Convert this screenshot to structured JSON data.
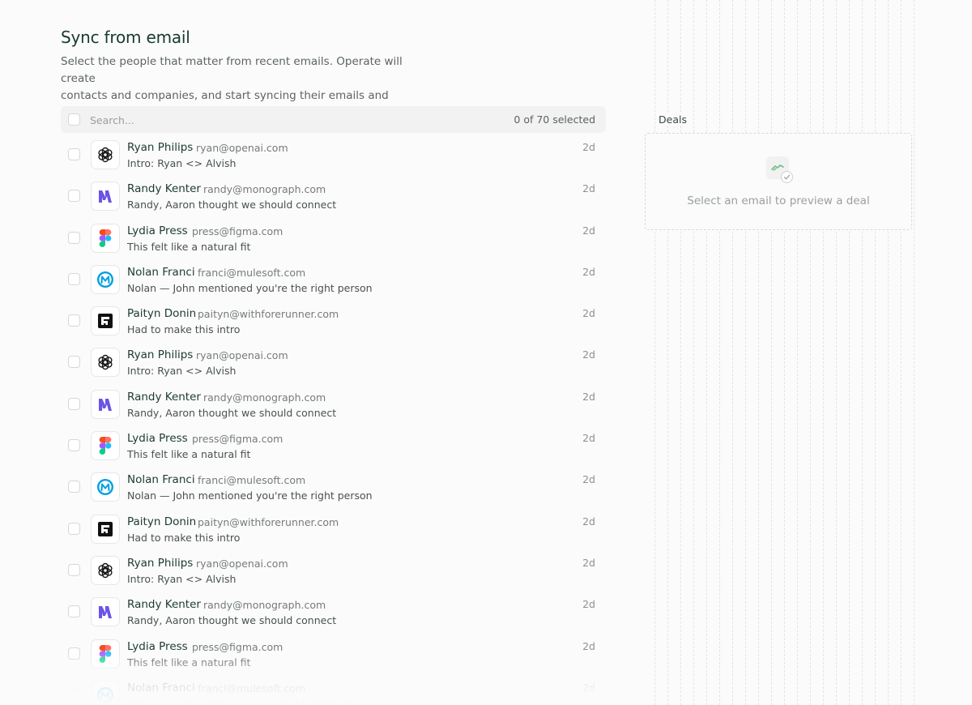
{
  "header": {
    "title": "Sync from email",
    "subtitle_line1": "Select the people that matter from recent emails. Operate will create",
    "subtitle_line2": "contacts and companies, and start syncing their emails and meetings."
  },
  "search": {
    "placeholder": "Search...",
    "selected_count": "0 of 70 selected"
  },
  "emails": [
    {
      "name": "Ryan Philips",
      "email": "ryan@openai.com",
      "snippet": "Intro: Ryan <> Alvish",
      "time": "2d",
      "logo": "openai-logo-icon"
    },
    {
      "name": "Randy Kenter",
      "email": "randy@monograph.com",
      "snippet": "Randy, Aaron thought we should connect",
      "time": "2d",
      "logo": "monograph-logo-icon"
    },
    {
      "name": "Lydia Press",
      "email": "press@figma.com",
      "snippet": "This felt like a natural fit",
      "time": "2d",
      "logo": "figma-logo-icon"
    },
    {
      "name": "Nolan Franci",
      "email": "franci@mulesoft.com",
      "snippet": "Nolan — John mentioned you're the right person",
      "time": "2d",
      "logo": "mulesoft-logo-icon"
    },
    {
      "name": "Paityn Donin",
      "email": "paityn@withforerunner.com",
      "snippet": "Had to make this intro",
      "time": "2d",
      "logo": "forerunner-logo-icon"
    },
    {
      "name": "Ryan Philips",
      "email": "ryan@openai.com",
      "snippet": "Intro: Ryan <> Alvish",
      "time": "2d",
      "logo": "openai-logo-icon"
    },
    {
      "name": "Randy Kenter",
      "email": "randy@monograph.com",
      "snippet": "Randy, Aaron thought we should connect",
      "time": "2d",
      "logo": "monograph-logo-icon"
    },
    {
      "name": "Lydia Press",
      "email": "press@figma.com",
      "snippet": "This felt like a natural fit",
      "time": "2d",
      "logo": "figma-logo-icon"
    },
    {
      "name": "Nolan Franci",
      "email": "franci@mulesoft.com",
      "snippet": "Nolan — John mentioned you're the right person",
      "time": "2d",
      "logo": "mulesoft-logo-icon"
    },
    {
      "name": "Paityn Donin",
      "email": "paityn@withforerunner.com",
      "snippet": "Had to make this intro",
      "time": "2d",
      "logo": "forerunner-logo-icon"
    },
    {
      "name": "Ryan Philips",
      "email": "ryan@openai.com",
      "snippet": "Intro: Ryan <> Alvish",
      "time": "2d",
      "logo": "openai-logo-icon"
    },
    {
      "name": "Randy Kenter",
      "email": "randy@monograph.com",
      "snippet": "Randy, Aaron thought we should connect",
      "time": "2d",
      "logo": "monograph-logo-icon"
    },
    {
      "name": "Lydia Press",
      "email": "press@figma.com",
      "snippet": "This felt like a natural fit",
      "time": "2d",
      "logo": "figma-logo-icon"
    },
    {
      "name": "Nolan Franci",
      "email": "franci@mulesoft.com",
      "snippet": "Nolan — John mentioned you're the right person",
      "time": "2d",
      "logo": "mulesoft-logo-icon"
    }
  ],
  "deals": {
    "label": "Deals",
    "empty_text": "Select an email to preview a deal",
    "icon": "handshake-icon"
  },
  "colors": {
    "title": "#173a30",
    "monograph": "#6b54e6",
    "mulesoft": "#00a0df",
    "deal_icon": "#6fbf84"
  }
}
